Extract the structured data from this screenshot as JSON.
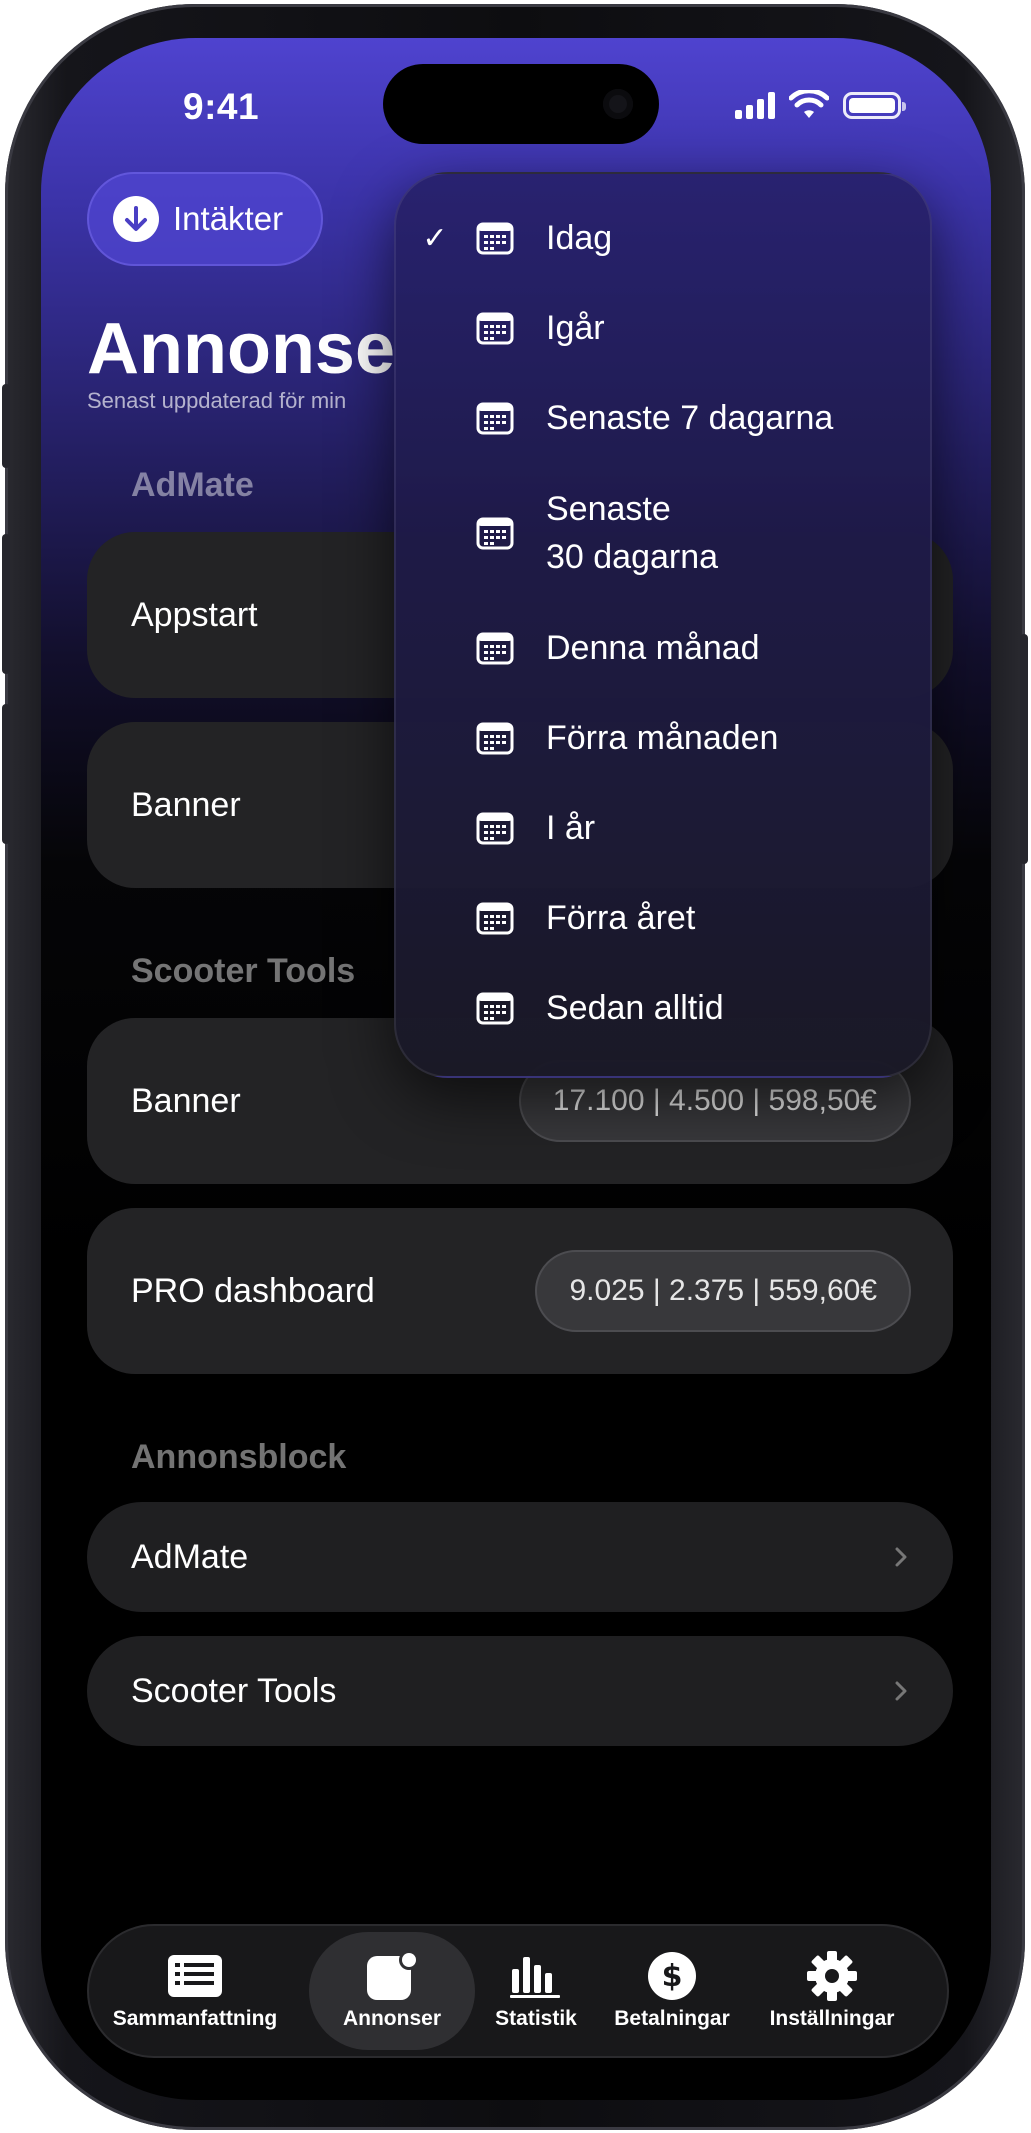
{
  "status_bar": {
    "time": "9:41"
  },
  "header": {
    "income_button_label": "Intäkter",
    "title": "Annonse",
    "subtitle": "Senast uppdaterad för min"
  },
  "sections": [
    {
      "title": "AdMate",
      "items": [
        {
          "label": "Appstart",
          "stats": ""
        },
        {
          "label": "Banner",
          "stats": ""
        }
      ]
    },
    {
      "title": "Scooter Tools",
      "items": [
        {
          "label": "Banner",
          "stats": "17.100 | 4.500 | 598,50€"
        },
        {
          "label": "PRO dashboard",
          "stats": "9.025 | 2.375 | 559,60€"
        }
      ]
    }
  ],
  "ad_blocks": {
    "title": "Annonsblock",
    "items": [
      {
        "label": "AdMate"
      },
      {
        "label": "Scooter Tools"
      }
    ]
  },
  "date_menu": {
    "selected": "Idag",
    "items": [
      {
        "label": "Idag",
        "icon": "calendar-icon",
        "checked": true
      },
      {
        "label": "Igår",
        "icon": "calendar-icon"
      },
      {
        "label": "Senaste 7 dagarna",
        "icon": "calendar-icon"
      },
      {
        "label_line1": "Senaste",
        "label_line2": "30 dagarna",
        "icon": "calendar-icon"
      },
      {
        "label": "Denna månad",
        "icon": "calendar-icon"
      },
      {
        "label": "Förra månaden",
        "icon": "calendar-icon"
      },
      {
        "label": "I år",
        "icon": "calendar-icon"
      },
      {
        "label": "Förra året",
        "icon": "calendar-icon"
      },
      {
        "label": "Sedan alltid",
        "icon": "calendar-icon"
      }
    ]
  },
  "tab_bar": {
    "active": "Annonser",
    "tabs": [
      {
        "label": "Sammanfattning",
        "icon": "list-icon"
      },
      {
        "label": "Annonser",
        "icon": "ad-notification-icon"
      },
      {
        "label": "Statistik",
        "icon": "bar-chart-icon"
      },
      {
        "label": "Betalningar",
        "icon": "dollar-icon"
      },
      {
        "label": "Inställningar",
        "icon": "gear-icon"
      }
    ]
  },
  "colors": {
    "accent": "#5a4fd8",
    "card_background": "#232325",
    "background": "#000000"
  }
}
